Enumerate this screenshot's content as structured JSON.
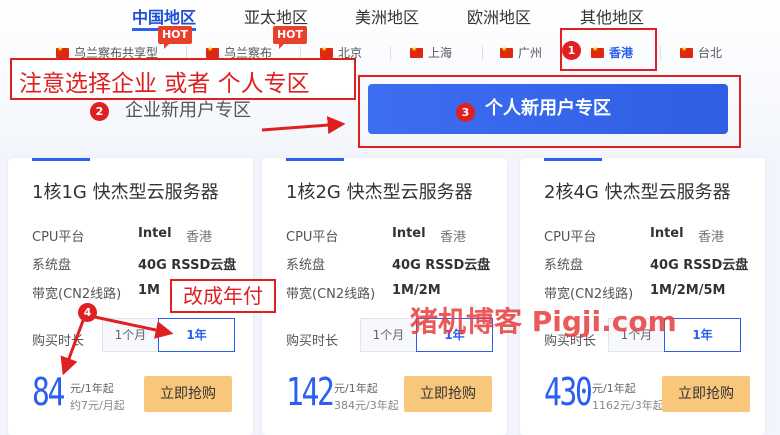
{
  "region_tabs": [
    {
      "label": "中国地区"
    },
    {
      "label": "亚太地区"
    },
    {
      "label": "美洲地区"
    },
    {
      "label": "欧洲地区"
    },
    {
      "label": "其他地区"
    }
  ],
  "cities": [
    {
      "label": "乌兰察布共享型",
      "hot": "HOT"
    },
    {
      "label": "乌兰察布",
      "hot": "HOT"
    },
    {
      "label": "北京"
    },
    {
      "label": "上海"
    },
    {
      "label": "广州"
    },
    {
      "label": "香港"
    },
    {
      "label": "台北"
    }
  ],
  "annotations": {
    "choose_note": "注意选择企业 或者  个人专区",
    "step1": "1",
    "step2": "2",
    "step3": "3",
    "step4": "4",
    "change_note": "改成年付"
  },
  "enterprise_zone_label": "企业新用户专区",
  "personal_zone_button": "个人新用户专区",
  "watermark": "猪机博客 Pigji.com",
  "spec_labels": {
    "cpu": "CPU平台",
    "disk": "系统盘",
    "bandwidth": "带宽(CN2线路)",
    "duration": "购买时长"
  },
  "cards": [
    {
      "title": "1核1G 快杰型云服务器",
      "cpu": "Intel",
      "region": "香港",
      "disk": "40G RSSD云盘",
      "bandwidth": "1M",
      "options": [
        "1个月",
        "1年"
      ],
      "price": "84",
      "unit": "元/1年起",
      "sub": "约7元/月起",
      "buy": "立即抢购"
    },
    {
      "title": "1核2G 快杰型云服务器",
      "cpu": "Intel",
      "region": "香港",
      "disk": "40G RSSD云盘",
      "bandwidth": "1M/2M",
      "options": [
        "1个月",
        "1年"
      ],
      "price": "142",
      "unit": "元/1年起",
      "sub": "384元/3年起",
      "buy": "立即抢购"
    },
    {
      "title": "2核4G 快杰型云服务器",
      "cpu": "Intel",
      "region": "香港",
      "disk": "40G RSSD云盘",
      "bandwidth": "1M/2M/5M",
      "options": [
        "1个月",
        "1年"
      ],
      "price": "430",
      "unit": "元/1年起",
      "sub": "1162元/3年起",
      "buy": "立即抢购"
    }
  ],
  "colors": {
    "accent": "#2a5ff0",
    "annotation": "#e02020",
    "buy_button": "#f9c77b"
  }
}
